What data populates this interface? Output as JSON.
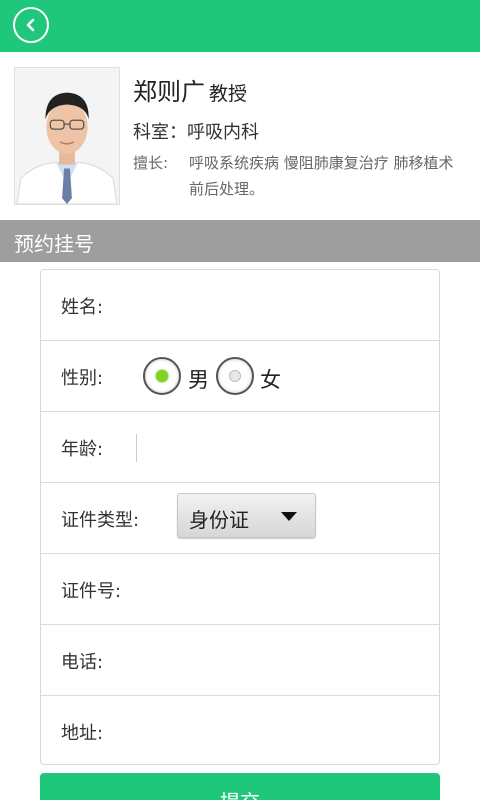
{
  "header": {
    "back_icon": "chevron-left-icon",
    "bg_color": "#1fc77b"
  },
  "doctor": {
    "name": "郑则广",
    "title": "教授",
    "department_line": "科室：呼吸内科",
    "specialty_label": "擅长:",
    "specialty_text": "呼吸系统疾病 慢阻肺康复治疗 肺移植术前后处理。"
  },
  "section": {
    "title": "预约挂号"
  },
  "form": {
    "name_label": "姓名:",
    "gender_label": "性别:",
    "gender_options": [
      {
        "label": "男",
        "selected": true
      },
      {
        "label": "女",
        "selected": false
      }
    ],
    "age_label": "年龄:",
    "id_type_label": "证件类型:",
    "id_type_value": "身份证",
    "id_number_label": "证件号:",
    "phone_label": "电话:",
    "address_label": "地址:"
  },
  "submit": {
    "label": "提交"
  }
}
